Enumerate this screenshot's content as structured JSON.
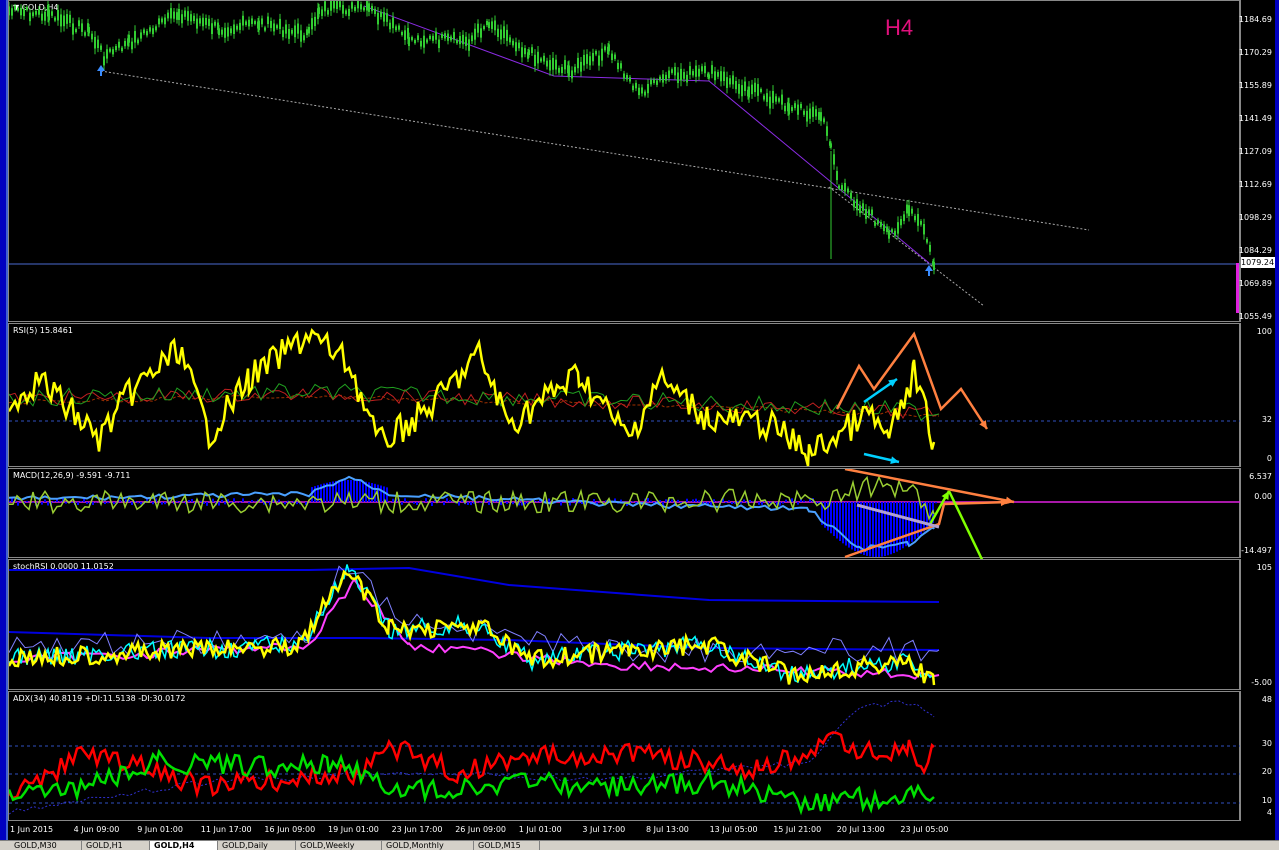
{
  "symbol_title": "GOLD,H4",
  "timeframe_label": "H4",
  "current_price": "1079.24",
  "price_axis": [
    "1184.69",
    "1170.29",
    "1155.89",
    "1141.49",
    "1127.09",
    "1112.69",
    "1098.29",
    "1084.29",
    "1069.89",
    "1055.49"
  ],
  "rsi": {
    "title": "RSI(5) 15.8461",
    "levels": [
      "100",
      "32",
      "0"
    ]
  },
  "macd": {
    "title": "MACD(12,26,9) -9.591 -9.711",
    "levels": [
      "6.537",
      "0.00",
      "-14.497"
    ]
  },
  "stochrsi": {
    "title": "stochRSI 0.0000 11.0152",
    "levels": [
      "105",
      "-5.00"
    ]
  },
  "adx": {
    "title": "ADX(34) 40.8119 +DI:11.5138 -DI:30.0172",
    "levels": [
      "48",
      "30",
      "20",
      "10",
      "4"
    ]
  },
  "time_axis": [
    "1 Jun 2015",
    "4 Jun 09:00",
    "9 Jun 01:00",
    "11 Jun 17:00",
    "16 Jun 09:00",
    "19 Jun 01:00",
    "23 Jun 17:00",
    "26 Jun 09:00",
    "1 Jul 01:00",
    "3 Jul 17:00",
    "8 Jul 13:00",
    "13 Jul 05:00",
    "15 Jul 21:00",
    "20 Jul 13:00",
    "23 Jul 05:00"
  ],
  "tabs": [
    "GOLD,M30",
    "GOLD,H1",
    "GOLD,H4",
    "GOLD,Daily",
    "GOLD,Weekly",
    "GOLD,Monthly",
    "GOLD,M15"
  ],
  "active_tab": "GOLD,H4",
  "colors": {
    "candles": "#32cd32",
    "rsi": "#ffff00",
    "macd_hist": "#0000ff",
    "stoch": "#ffff00",
    "adx_plus": "#00e000",
    "adx_minus": "#ff0000",
    "arrow_orange": "#ff8040",
    "arrow_cyan": "#00d0ff",
    "arrow_green": "#80ff00"
  }
}
